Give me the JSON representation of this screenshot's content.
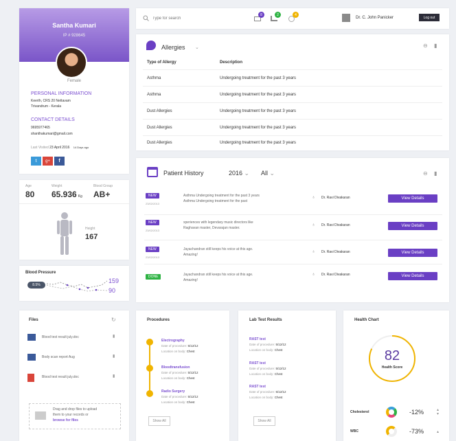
{
  "profile": {
    "name": "Santha Kumari",
    "ip": "IP # 928645",
    "gender": "Female",
    "personal_title": "PERSONAL INFORMATION",
    "address1": "Keerth, CRS 20 Nettavam",
    "address2": "Trivandrum - Kerala",
    "contact_title": "CONTACT DETAILS",
    "phone": "9695977465",
    "email": "shanthakumari@gmail.com",
    "last_visited_label": "Last Visited",
    "last_visited": "23 April 2016",
    "days_ago": "14 Days ago",
    "social": {
      "twitter": "t",
      "google": "g+",
      "facebook": "f"
    }
  },
  "topbar": {
    "search_placeholder": "Type for search",
    "badges": [
      "8",
      "2",
      "4"
    ],
    "doctor": "Dr. C. John Panicker",
    "logout": "Log out"
  },
  "allergies": {
    "title": "Allergies",
    "col1": "Type of Allergy",
    "col2": "Description",
    "rows": [
      [
        "Asthma",
        "Undergoing treatment for the past 3 years"
      ],
      [
        "Asthma",
        "Undergoing treatment for the past 3 years"
      ],
      [
        "Dust Allergies",
        "Undergoing treatment for the past 3 years"
      ],
      [
        "Dust Allergies",
        "Undergoing treatment for the past 3 years"
      ],
      [
        "Dust Allergies",
        "Undergoing treatment for the past 3 years"
      ]
    ]
  },
  "vitals": {
    "age_label": "Age",
    "age": "80",
    "weight_label": "Weight",
    "weight": "65.936",
    "weight_unit": "Kg",
    "blood_label": "Blood Group",
    "blood": "AB+",
    "height_label": "Height",
    "height": "167"
  },
  "bp": {
    "title": "Blood Pressure",
    "pct": "8.5%",
    "high": "159",
    "low": "90"
  },
  "history": {
    "title": "Patient History",
    "year": "2016",
    "filter": "All",
    "rows": [
      {
        "tag": "NEW",
        "date": "23/02/2013",
        "line1": "Asthma Undergoing treatment for the past 3 years",
        "line2": "Asthma Undergoing treatment for the past",
        "doctor": "Dr. Ravi Divakaran",
        "btn": "View Details"
      },
      {
        "tag": "NEW",
        "date": "23/02/2013",
        "line1": "xperiences with legendary music directors like",
        "line2": "Raghavan master, Devarajan master.",
        "doctor": "Dr. Ravi Divakaran",
        "btn": "View Details"
      },
      {
        "tag": "NEW",
        "date": "23/02/2013",
        "line1": "Jayachandran still keeps his voice at this age.",
        "line2": "Amazing!",
        "doctor": "Dr. Ravi Divakaran",
        "btn": "View Details"
      },
      {
        "tag": "DONE",
        "date": "",
        "line1": "Jayachandran still keeps his voice at this age.",
        "line2": "Amazing!",
        "doctor": "Dr. Ravi Divakaran",
        "btn": "View Details"
      }
    ]
  },
  "files": {
    "title": "Files",
    "items": [
      "Blood test result july.doc",
      "Body scan report Aug",
      "Blood test result july.doc"
    ],
    "drop1": "Drag and drop files to upload",
    "drop2": "them to your records or",
    "drop_link": "browse for files"
  },
  "procedures": {
    "title": "Procedures",
    "items": [
      {
        "name": "Electrography",
        "date_label": "Date of procedure:",
        "date": "5/12/12",
        "loc_label": "Location on body:",
        "loc": "Chest"
      },
      {
        "name": "Bloodtransfusion",
        "date_label": "Date of procedure:",
        "date": "5/12/12",
        "loc_label": "Location on body:",
        "loc": "Chest"
      },
      {
        "name": "Radio Surgery",
        "date_label": "Date of procedure:",
        "date": "5/12/12",
        "loc_label": "Location on body:",
        "loc": "Chest"
      }
    ],
    "show_all": "Show All"
  },
  "labs": {
    "title": "Lab Test Results",
    "items": [
      {
        "name": "RAST test",
        "date_label": "Date of procedure:",
        "date": "5/12/12",
        "loc_label": "Location on body:",
        "loc": "Chest"
      },
      {
        "name": "RAST test",
        "date_label": "Date of procedure:",
        "date": "5/12/12",
        "loc_label": "Location on body:",
        "loc": "Chest"
      },
      {
        "name": "RAST test",
        "date_label": "Date of procedure:",
        "date": "5/12/12",
        "loc_label": "Location on body:",
        "loc": "Chest"
      }
    ],
    "show_all": "Show All"
  },
  "health": {
    "title": "Health Chart",
    "score": "82",
    "score_label": "Health Score",
    "score_fraction": 0.82,
    "metrics": [
      {
        "name": "Cholesterol",
        "value": "-12%"
      },
      {
        "name": "WBC",
        "value": "-73%"
      }
    ]
  },
  "colors": {
    "accent": "#6a3fc4",
    "gold": "#f0b400",
    "green": "#2fb344"
  }
}
